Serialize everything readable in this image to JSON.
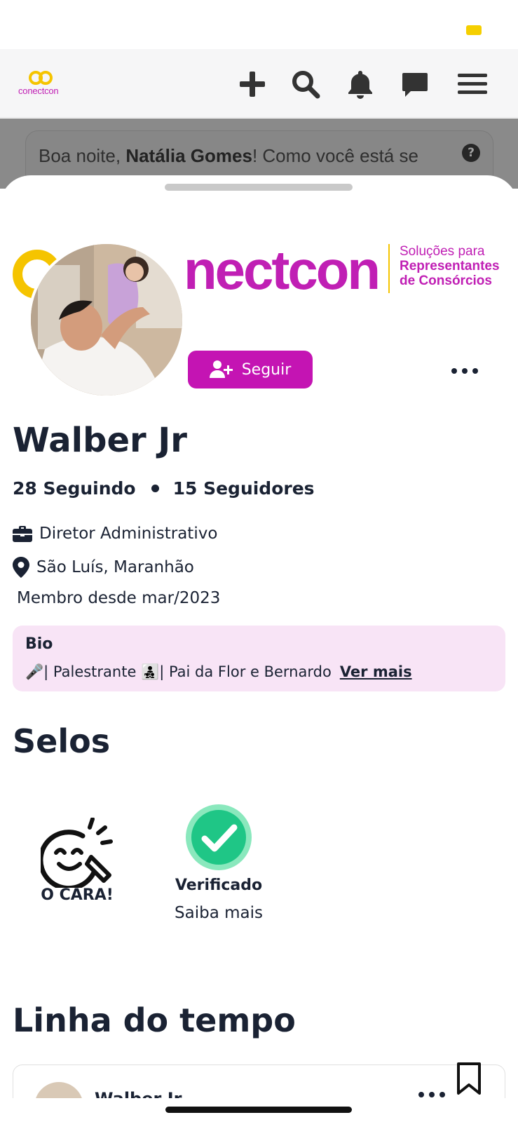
{
  "brand": {
    "accent": "#c414b3",
    "yellow": "#f5c400",
    "text_dark": "#1a2233",
    "logo_small_text": "conectcon",
    "banner_word": "nectcon",
    "banner_tag_line1": "Soluções para",
    "banner_tag_line2": "Representantes",
    "banner_tag_line3": "de Consórcios"
  },
  "header": {
    "icons": [
      "plus-icon",
      "search-icon",
      "bell-icon",
      "chat-icon",
      "menu-icon"
    ]
  },
  "greeting": {
    "prefix": "Boa noite, ",
    "name": "Natália Gomes",
    "suffix": "! Como você está se"
  },
  "profile": {
    "name": "Walber Jr",
    "following": "28 Seguindo",
    "followers": "15 Seguidores",
    "follow_button": "Seguir",
    "job": "Diretor Administrativo",
    "location": "São Luís, Maranhão",
    "member_since": "Membro desde mar/2023"
  },
  "bio": {
    "title": "Bio",
    "text": "🎤| Palestrante 👨‍👧‍👦| Pai da Flor e Bernardo",
    "more": "Ver mais"
  },
  "seals": {
    "title": "Selos",
    "items": [
      {
        "label": "O CARA!",
        "icon": "smiley-icon"
      },
      {
        "label": "Verificado",
        "icon": "check-badge-icon",
        "link": "Saiba mais"
      }
    ]
  },
  "timeline": {
    "title": "Linha do tempo",
    "first_post_author": "Walber Jr"
  }
}
